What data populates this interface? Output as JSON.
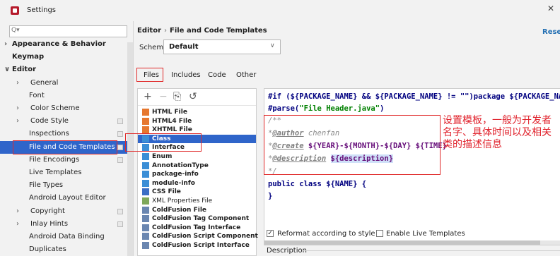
{
  "window": {
    "title": "Settings"
  },
  "sidebar": {
    "search_placeholder": "Q▾",
    "items": [
      {
        "label": "Appearance & Behavior",
        "arrow": "›",
        "bold": true
      },
      {
        "label": "Keymap",
        "bold": true
      },
      {
        "label": "Editor",
        "arrow": "∨",
        "bold": true
      },
      {
        "label": "General",
        "arrow": "›"
      },
      {
        "label": "Font"
      },
      {
        "label": "Color Scheme",
        "arrow": "›"
      },
      {
        "label": "Code Style",
        "arrow": "›"
      },
      {
        "label": "Inspections"
      },
      {
        "label": "File and Code Templates",
        "selected": true
      },
      {
        "label": "File Encodings"
      },
      {
        "label": "Live Templates"
      },
      {
        "label": "File Types"
      },
      {
        "label": "Android Layout Editor"
      },
      {
        "label": "Copyright",
        "arrow": "›"
      },
      {
        "label": "Inlay Hints",
        "arrow": "›"
      },
      {
        "label": "Android Data Binding"
      },
      {
        "label": "Duplicates"
      }
    ]
  },
  "header": {
    "crumb_parent": "Editor",
    "crumb_sep": "›",
    "crumb_current": "File and Code Templates",
    "reset_label": "Reset"
  },
  "scheme": {
    "label": "Scheme:",
    "value": "Default"
  },
  "tabs": [
    "Files",
    "Includes",
    "Code",
    "Other"
  ],
  "toolbar": {
    "add": "+",
    "remove": "−",
    "copy": "⎘",
    "reset": "↺"
  },
  "templates": [
    {
      "label": "HTML File",
      "icon_color": "#e6772e"
    },
    {
      "label": "HTML4 File",
      "icon_color": "#e6772e"
    },
    {
      "label": "XHTML File",
      "icon_color": "#e6772e"
    },
    {
      "label": "Class",
      "icon_color": "#3b8ed6",
      "selected": true
    },
    {
      "label": "Interface",
      "icon_color": "#3b8ed6"
    },
    {
      "label": "Enum",
      "icon_color": "#3b8ed6"
    },
    {
      "label": "AnnotationType",
      "icon_color": "#3b8ed6"
    },
    {
      "label": "package-info",
      "icon_color": "#3b8ed6"
    },
    {
      "label": "module-info",
      "icon_color": "#3b8ed6"
    },
    {
      "label": "CSS File",
      "icon_color": "#3b6ec4"
    },
    {
      "label": "XML Properties File",
      "icon_color": "#7fa85a",
      "normal": true
    },
    {
      "label": "ColdFusion File",
      "icon_color": "#6a86b0"
    },
    {
      "label": "ColdFusion Tag Component",
      "icon_color": "#6a86b0"
    },
    {
      "label": "ColdFusion Tag Interface",
      "icon_color": "#6a86b0"
    },
    {
      "label": "ColdFusion Script Component",
      "icon_color": "#6a86b0"
    },
    {
      "label": "ColdFusion Script Interface",
      "icon_color": "#6a86b0"
    }
  ],
  "code": {
    "line1": "#if (${PACKAGE_NAME} && ${PACKAGE_NAME} != \"\")package ${PACKAGE_NAME};#end",
    "line2_directive": "#parse(",
    "line2_string": "\"File Header.java\"",
    "line2_close": ")",
    "line3": "/**",
    "line4_tag": "@author",
    "line4_text": " chenfan",
    "line5_tag": "@create",
    "line5_text": " ${YEAR}-${MONTH}-${DAY} ${TIME}",
    "line6_tag": "@description",
    "line6_var": "${description}",
    "line7": "*/",
    "line8": "public class ${NAME} {",
    "line9": "}"
  },
  "options": {
    "reformat_label": "Reformat according to style",
    "reformat_checked": "✓",
    "live_templates_label": "Enable Live Templates"
  },
  "description_label": "Description",
  "annotation": "设置模板，一般为开发者名字、具体时间以及相关类的描述信息",
  "colors": {
    "accent": "#2f65ca",
    "annotation_red": "#e02a2a",
    "link": "#2470b3"
  }
}
